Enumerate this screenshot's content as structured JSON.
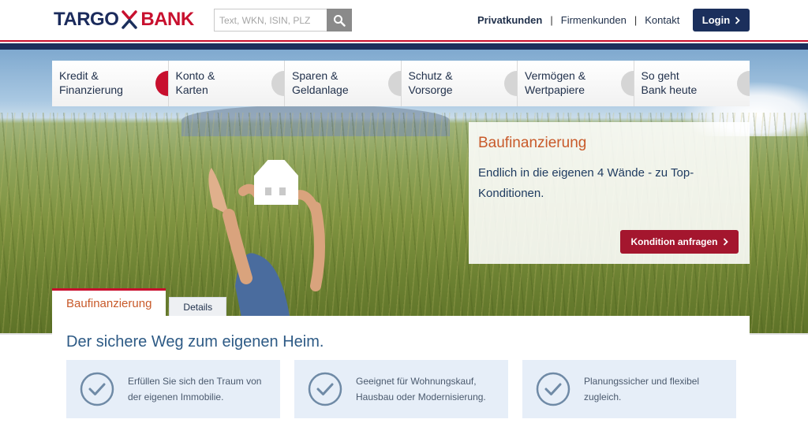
{
  "brand": {
    "name_left": "TARGO",
    "name_right": "BANK",
    "colors": {
      "navy": "#1b2f5c",
      "red": "#c8102e"
    }
  },
  "search": {
    "placeholder": "Text, WKN, ISIN, PLZ",
    "icon": "search-icon"
  },
  "top_nav": {
    "items": [
      "Privatkunden",
      "Firmenkunden",
      "Kontakt"
    ],
    "active": "Privatkunden"
  },
  "login": {
    "label": "Login"
  },
  "category_nav": {
    "items": [
      {
        "line1": "Kredit &",
        "line2": "Finanzierung",
        "active": true
      },
      {
        "line1": "Konto &",
        "line2": "Karten"
      },
      {
        "line1": "Sparen &",
        "line2": "Geldanlage"
      },
      {
        "line1": "Schutz &",
        "line2": "Vorsorge"
      },
      {
        "line1": "Vermögen &",
        "line2": "Wertpapiere"
      },
      {
        "line1": "So geht",
        "line2": "Bank heute"
      }
    ]
  },
  "teaser": {
    "title": "Baufinanzierung",
    "text": "Endlich in die eigenen 4 Wände - zu Top-Konditionen.",
    "button": "Kondition anfragen"
  },
  "content_tabs": {
    "active": "Baufinanzierung",
    "other": "Details"
  },
  "content": {
    "heading": "Der sichere Weg zum eigenen Heim.",
    "features": [
      {
        "line1": "Erfüllen Sie sich den Traum von",
        "line2": "der eigenen Immobilie."
      },
      {
        "line1": "Geeignet für Wohnungskauf,",
        "line2": "Hausbau oder Modernisierung."
      },
      {
        "line1": "Planungssicher und flexibel",
        "line2": "zugleich."
      }
    ]
  }
}
